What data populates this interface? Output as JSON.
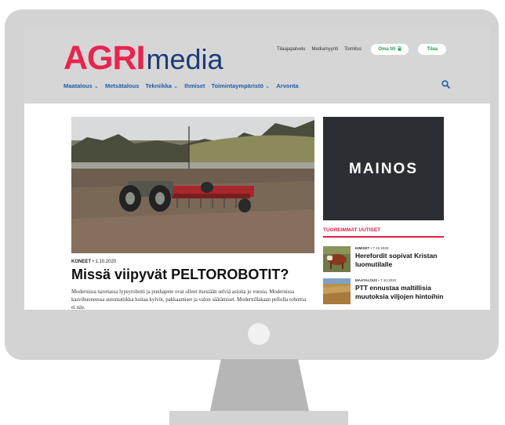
{
  "brand": {
    "name_bold": "AGRI",
    "name_light": "media"
  },
  "colors": {
    "brand_red": "#e8244f",
    "brand_blue": "#1d3b78",
    "nav_blue": "#1e5daa",
    "accent_green": "#1f9c52",
    "ad_bg": "#2b2e33"
  },
  "top_links": [
    "Tilaajapalvelu",
    "Mediamyynti",
    "Toimitus"
  ],
  "buttons": {
    "oma_tili": "Oma tili",
    "tilaa": "Tilaa"
  },
  "nav": [
    {
      "label": "Maatalous",
      "dropdown": true
    },
    {
      "label": "Metsätalous",
      "dropdown": false
    },
    {
      "label": "Tekniikka",
      "dropdown": true
    },
    {
      "label": "Ihmiset",
      "dropdown": false
    },
    {
      "label": "Toimintaympäristö",
      "dropdown": true
    },
    {
      "label": "Arvonta",
      "dropdown": false
    }
  ],
  "icons": {
    "search": "search-icon",
    "account": "lock-icon",
    "dropdown": "chevron-down-icon"
  },
  "article": {
    "category": "KONEET",
    "date": "1.10.2020",
    "title": "Missä viipyvät PELTOROBOTIT?",
    "lead": "Modernissa navetassa lypsyrobotti ja puuhapete ovat olleet itsestään selviä asioita jo vuosia. Modernissa kasvihuoneessa automatiikka hoitaa kylvöt, pakkaamiset ja valon säätämiset. Modernillakaan pellolla robottia ei näy."
  },
  "ad": {
    "label": "MAINOS"
  },
  "latest": {
    "heading": "TUOREIMMAT UUTISET",
    "items": [
      {
        "category": "IHMISET",
        "date": "7.10.2020",
        "title": "Herefordit sopivat Kristan luomutilalle"
      },
      {
        "category": "MAATALOUS",
        "date": "7.10.2020",
        "title": "PTT ennustaa maltillisia muutoksia viljojen hintoihin"
      }
    ]
  }
}
